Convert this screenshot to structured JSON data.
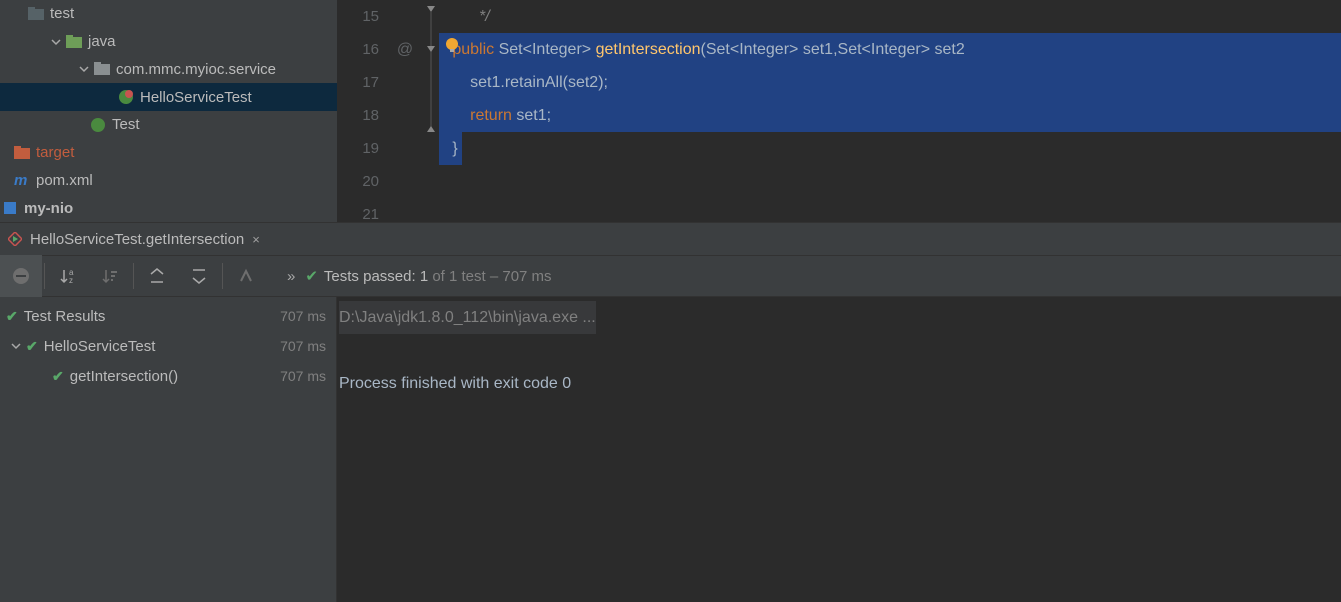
{
  "tree": {
    "test_label": "test",
    "java_label": "java",
    "pkg_label": "com.mmc.myioc.service",
    "hst_label": "HelloServiceTest",
    "tst_label": "Test",
    "target_label": "target",
    "pom_label": "pom.xml",
    "mynio_label": "my-nio"
  },
  "editor": {
    "lines": {
      "l15": "15",
      "l16": "16",
      "l17": "17",
      "l18": "18",
      "l19": "19",
      "l20": "20",
      "l21": "21"
    },
    "at": "@",
    "comment_end": "*/",
    "kw_public": "public",
    "type_set": "Set",
    "type_integer": "Integer",
    "m_name": "getIntersection",
    "p1": "set1",
    "p2": "set2",
    "l17_code": "set1.retainAll(set2);",
    "kw_return": "return",
    "ret_expr": " set1;",
    "brace_close": "}"
  },
  "runtab": {
    "label": "HelloServiceTest.getIntersection",
    "close": "×"
  },
  "toolbar": {
    "arrows": "»",
    "status_prefix": "Tests passed: ",
    "status_count": "1",
    "status_suffix": " of 1 test – 707 ms"
  },
  "tests": {
    "root": "Test Results",
    "root_time": "707 ms",
    "class": "HelloServiceTest",
    "class_time": "707 ms",
    "method": "getIntersection()",
    "method_time": "707 ms"
  },
  "console": {
    "cmd": "D:\\Java\\jdk1.8.0_112\\bin\\java.exe ...",
    "exit": "Process finished with exit code 0"
  }
}
